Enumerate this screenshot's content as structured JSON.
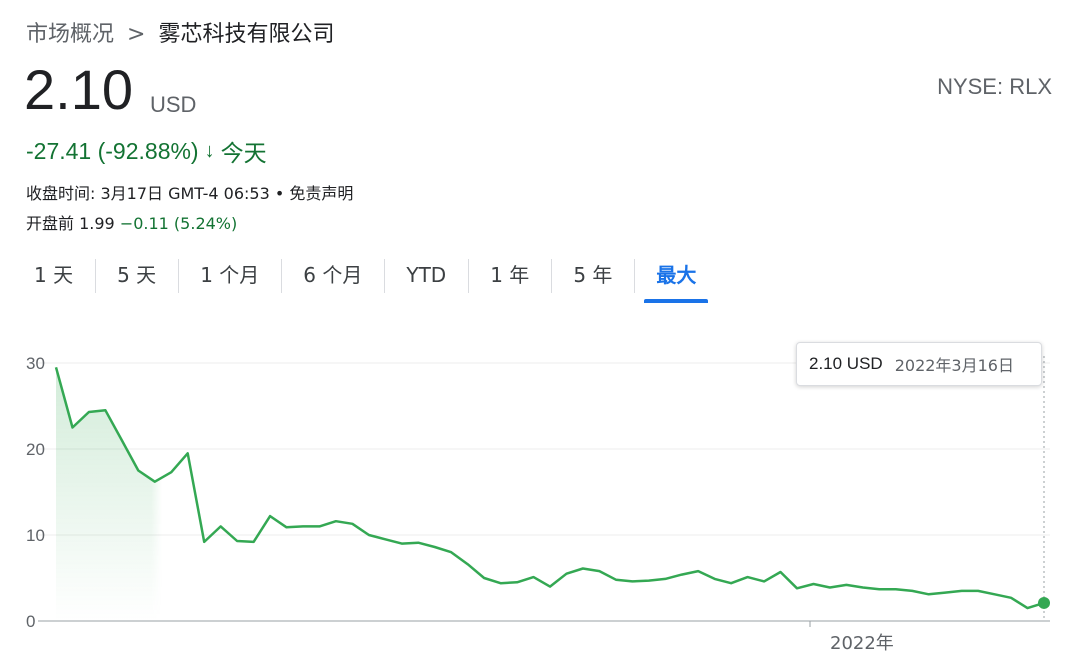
{
  "breadcrumb": {
    "root": "市场概况",
    "separator": ">",
    "company": "雾芯科技有限公司"
  },
  "quote": {
    "price": "2.10",
    "currency": "USD",
    "exchange_ticker": "NYSE: RLX",
    "change": "-27.41 (-92.88%)",
    "change_arrow": "↓",
    "change_period": "今天",
    "close_time": "收盘时间: 3月17日 GMT-4 06:53 • 免责声明",
    "premarket_label": "开盘前 1.99",
    "premarket_change": "−0.11 (5.24%)"
  },
  "tabs": [
    {
      "label": "1 天",
      "active": false
    },
    {
      "label": "5 天",
      "active": false
    },
    {
      "label": "1 个月",
      "active": false
    },
    {
      "label": "6 个月",
      "active": false
    },
    {
      "label": "YTD",
      "active": false
    },
    {
      "label": "1 年",
      "active": false
    },
    {
      "label": "5 年",
      "active": false
    },
    {
      "label": "最大",
      "active": true
    }
  ],
  "tooltip": {
    "price": "2.10 USD",
    "date": "2022年3月16日"
  },
  "colors": {
    "line": "#34a853",
    "positive": "#137333",
    "accent": "#1a73e8"
  },
  "chart_data": {
    "type": "line",
    "y_ticks": [
      0,
      10,
      20,
      30
    ],
    "ylim": [
      0,
      30
    ],
    "x_tick_label": "2022年",
    "grid": true,
    "values": [
      29.5,
      22.5,
      24.3,
      24.5,
      21.0,
      17.5,
      16.2,
      17.3,
      19.5,
      9.2,
      11.0,
      9.3,
      9.2,
      12.2,
      10.9,
      11.0,
      11.0,
      11.6,
      11.3,
      10.0,
      9.5,
      9.0,
      9.1,
      8.6,
      8.0,
      6.6,
      5.0,
      4.4,
      4.5,
      5.1,
      4.0,
      5.5,
      6.1,
      5.8,
      4.8,
      4.6,
      4.7,
      4.9,
      5.4,
      5.8,
      4.9,
      4.4,
      5.1,
      4.6,
      5.7,
      3.8,
      4.3,
      3.9,
      4.2,
      3.9,
      3.7,
      3.7,
      3.5,
      3.1,
      3.3,
      3.5,
      3.5,
      3.1,
      2.7,
      1.5,
      2.1
    ]
  }
}
